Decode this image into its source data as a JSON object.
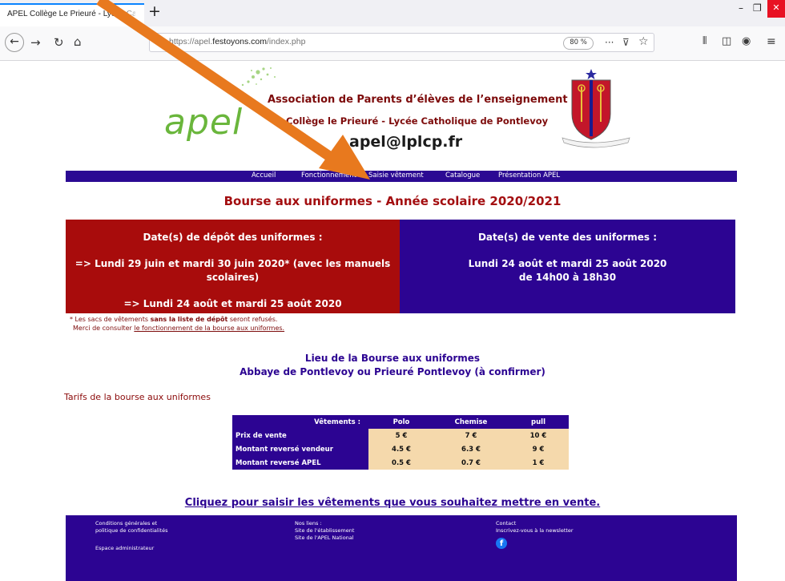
{
  "browser": {
    "tab_title": "APEL Collège Le Prieuré - Lycée Ca",
    "new_tab_symbol": "+",
    "url_prefix": "https://apel.",
    "url_domain": "festoyons.com",
    "url_suffix": "/index.php",
    "zoom": "80 %",
    "nav_icons": [
      "back-icon",
      "forward-icon",
      "reload-icon",
      "home-icon",
      "shield-icon",
      "more-icon",
      "pocket-icon",
      "bookmark-star-icon",
      "library-icon",
      "sidebar-icon",
      "account-icon",
      "menu-icon"
    ]
  },
  "header": {
    "logo_text": "apel",
    "line1": "Association de Parents d’élèves de l’enseignement libre",
    "line2": "Collège le Prieuré - Lycée Catholique de Pontlevoy",
    "email": "apel@lplcp.fr"
  },
  "menu": [
    "Accueil",
    "Fonctionnement",
    "Saisie vêtement",
    "Catalogue",
    "Présentation APEL"
  ],
  "title": "Bourse aux uniformes - Année scolaire 2020/2021",
  "deposit": {
    "heading": "Date(s) de dépôt des uniformes :",
    "line1": "=> Lundi 29 juin et mardi 30 juin 2020* (avec les manuels",
    "line2": "scolaires)",
    "line3": "=> Lundi 24 août et mardi 25 août 2020"
  },
  "sale": {
    "heading": "Date(s) de vente des uniformes :",
    "line1": "Lundi 24 août et mardi 25 août 2020",
    "line2": "de 14h00 à 18h30"
  },
  "note": {
    "star": "* Les sacs de vêtements ",
    "bold": "sans la liste de dépôt",
    "rest": " seront refusés.",
    "line2_prefix": "Merci de consulter ",
    "line2_link": "le fonctionnement de la bourse aux uniformes."
  },
  "location": {
    "line1": "Lieu de la Bourse aux uniformes",
    "line2": "Abbaye de Pontlevoy ou Prieuré Pontlevoy (à confirmer)"
  },
  "tarifs_title": "Tarifs de la bourse aux uniformes",
  "price_table": {
    "corner": "Vêtements :",
    "columns": [
      "Polo",
      "Chemise",
      "pull"
    ],
    "rows": [
      {
        "label": "Prix de vente",
        "values": [
          "5 €",
          "7 €",
          "10 €"
        ]
      },
      {
        "label": "Montant reversé vendeur",
        "values": [
          "4.5 €",
          "6.3 €",
          "9 €"
        ]
      },
      {
        "label": "Montant reversé APEL",
        "values": [
          "0.5 €",
          "0.7 €",
          "1 €"
        ]
      }
    ]
  },
  "cta": "Cliquez pour saisir les vêtements que vous souhaitez mettre en vente.",
  "footer": {
    "col1": [
      "Conditions générales et",
      "politique de confidentialités",
      "Espace administrateur"
    ],
    "col2_title": "Nos liens :",
    "col2_links": [
      "Site de l'établissement",
      "Site de l'APEL National"
    ],
    "col3_title": "Contact",
    "col3_link": "Inscrivez-vous à la newsletter",
    "social_icon": "facebook-icon"
  },
  "colors": {
    "menu_bg": "#2b0a93",
    "dark_red": "#a80c0c",
    "navy": "#2c0492",
    "table_value_bg": "#f5d9ac",
    "annotation_arrow": "#e8791e"
  }
}
